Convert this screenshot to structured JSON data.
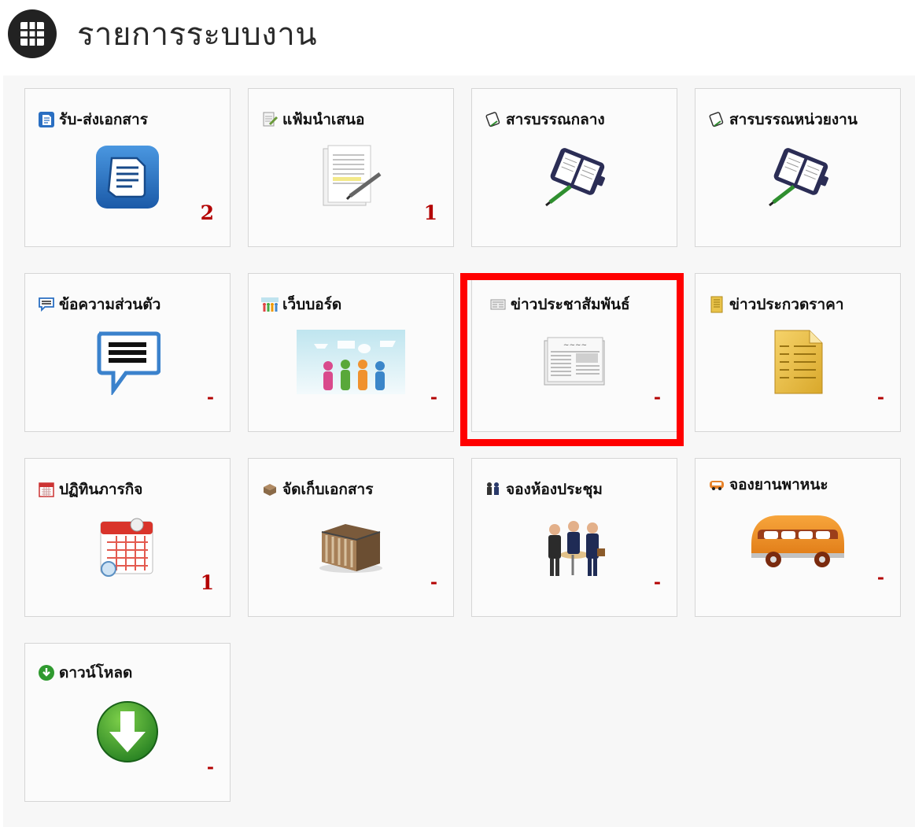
{
  "header": {
    "title": "รายการระบบงาน",
    "icon": "grid-icon"
  },
  "colors": {
    "count": "#b30000",
    "highlight": "#ff0000"
  },
  "tiles": [
    {
      "label": "รับ-ส่งเอกสาร",
      "count": "2",
      "icon": "document-icon"
    },
    {
      "label": "แฟ้มนำเสนอ",
      "count": "1",
      "icon": "paper-pen-icon"
    },
    {
      "label": "สารบรรณกลาง",
      "count": "",
      "icon": "planner-icon"
    },
    {
      "label": "สารบรรณหน่วยงาน",
      "count": "",
      "icon": "planner-icon"
    },
    {
      "label": "ข้อความส่วนตัว",
      "count": "-",
      "icon": "message-icon"
    },
    {
      "label": "เว็บบอร์ด",
      "count": "-",
      "icon": "people-chat-icon"
    },
    {
      "label": "ข่าวประชาสัมพันธ์",
      "count": "-",
      "icon": "newspaper-icon",
      "highlighted": true
    },
    {
      "label": "ข่าวประกวดราคา",
      "count": "-",
      "icon": "document-yellow-icon"
    },
    {
      "label": "ปฏิทินภารกิจ",
      "count": "1",
      "icon": "calendar-icon"
    },
    {
      "label": "จัดเก็บเอกสาร",
      "count": "-",
      "icon": "archive-box-icon"
    },
    {
      "label": "จองห้องประชุม",
      "count": "-",
      "icon": "meeting-icon"
    },
    {
      "label": "จองยานพาหนะ",
      "count": "-",
      "icon": "bus-icon"
    },
    {
      "label": "ดาวน์โหลด",
      "count": "-",
      "icon": "download-icon"
    }
  ]
}
